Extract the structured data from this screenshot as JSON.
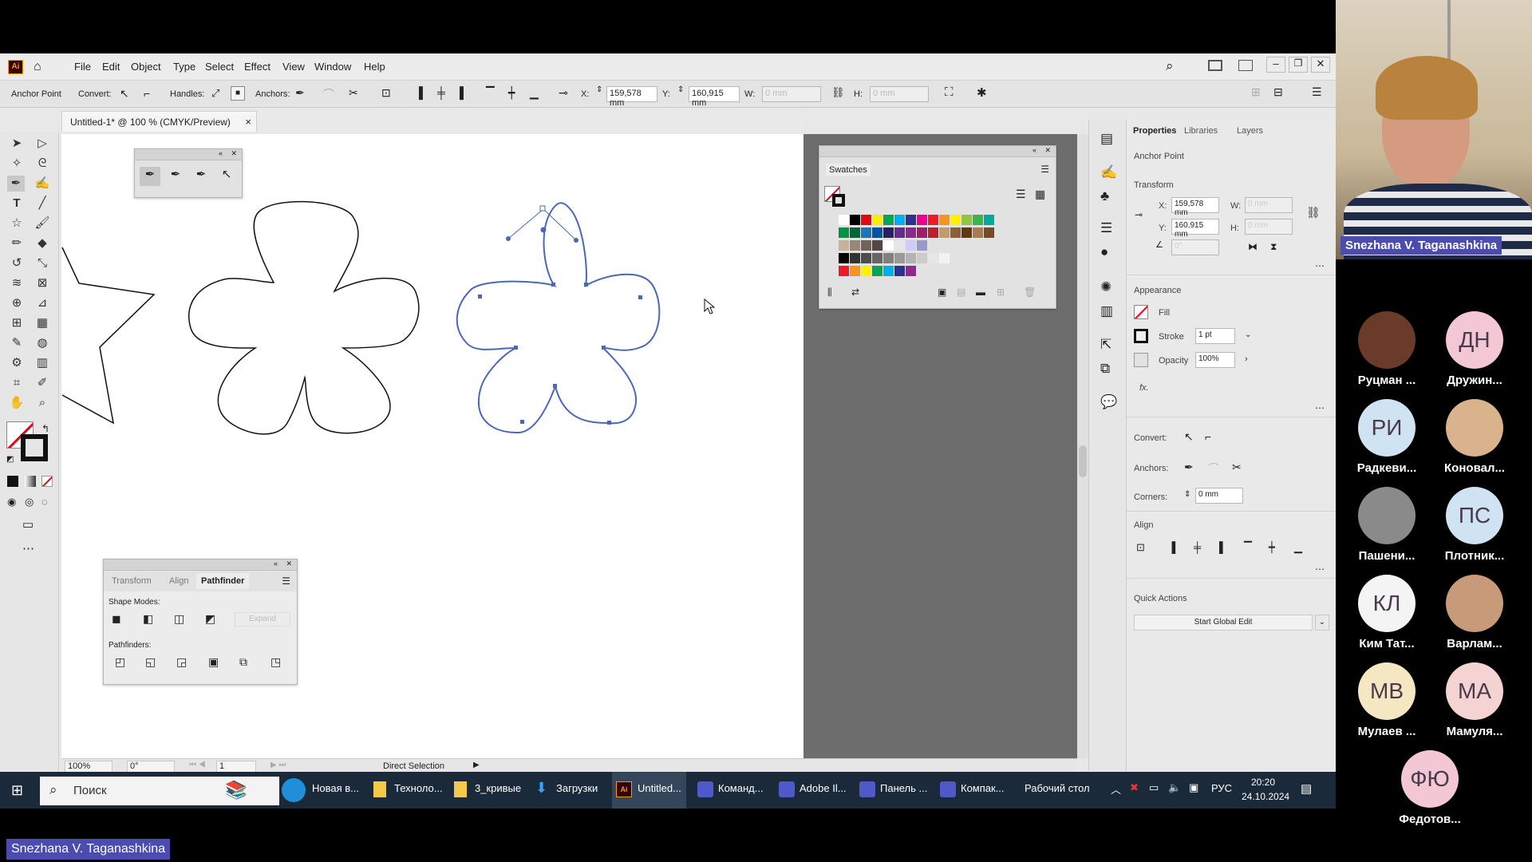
{
  "app": {
    "logo": "Ai",
    "menu": [
      "File",
      "Edit",
      "Object",
      "Type",
      "Select",
      "Effect",
      "View",
      "Window",
      "Help"
    ]
  },
  "control_bar": {
    "selection_label": "Anchor Point",
    "convert_label": "Convert:",
    "handles_label": "Handles:",
    "anchors_label": "Anchors:",
    "x_label": "X:",
    "x_value": "159,578 mm",
    "y_label": "Y:",
    "y_value": "160,915 mm",
    "w_label": "W:",
    "w_value": "0 mm",
    "h_label": "H:",
    "h_value": "0 mm"
  },
  "document": {
    "tab_title": "Untitled-1* @ 100 % (CMYK/Preview)",
    "close": "×"
  },
  "status": {
    "zoom": "100%",
    "rotate": "0°",
    "artboard_num": "1",
    "tool_name": "Direct Selection"
  },
  "swatches_panel": {
    "title": "Swatches",
    "colors_row1": [
      "#ffffff",
      "#000000",
      "#e30613",
      "#ffed00",
      "#00a651",
      "#00aeef",
      "#2e3192",
      "#ec008c",
      "#ed1c24",
      "#f7941d",
      "#fff200",
      "#8dc63f",
      "#39b54a",
      "#00a99d"
    ],
    "colors_row2": [
      "#009444",
      "#006838",
      "#1c75bc",
      "#0054a6",
      "#262262",
      "#662d91",
      "#92278f",
      "#9e1f63",
      "#be1e2d",
      "#c49a6c",
      "#8b5e3c",
      "#603913",
      "#a97c50",
      "#754c24"
    ],
    "colors_row3": [
      "#c7b299",
      "#998675",
      "#736357",
      "#534741",
      "#ffffff",
      "#e6e6e6",
      "#ccccff",
      "#9999cc"
    ],
    "colors_row4": [
      "#000000",
      "#333333",
      "#4d4d4d",
      "#666666",
      "#808080",
      "#999999",
      "#b3b3b3",
      "#cccccc",
      "#e6e6e6",
      "#f2f2f2"
    ],
    "colors_row5": [
      "#ed1c24",
      "#f7941d",
      "#fff200",
      "#00a651",
      "#00aeef",
      "#2e3192",
      "#92278f"
    ]
  },
  "pathfinder_panel": {
    "tabs": [
      "Transform",
      "Align",
      "Pathfinder"
    ],
    "shape_modes_label": "Shape Modes:",
    "expand_label": "Expand",
    "pathfinders_label": "Pathfinders:"
  },
  "properties_panel": {
    "tabs": [
      "Properties",
      "Libraries",
      "Layers"
    ],
    "selection": "Anchor Point",
    "transform_label": "Transform",
    "x_label": "X:",
    "x_value": "159,578 mm",
    "y_label": "Y:",
    "y_value": "160,915 mm",
    "w_label": "W:",
    "w_value": "0 mm",
    "h_label": "H:",
    "h_value": "0 mm",
    "angle_value": "0°",
    "appearance_label": "Appearance",
    "fill_label": "Fill",
    "stroke_label": "Stroke",
    "stroke_value": "1 pt",
    "opacity_label": "Opacity",
    "opacity_value": "100%",
    "fx_label": "fx.",
    "convert_label": "Convert:",
    "anchors_label": "Anchors:",
    "corners_label": "Corners:",
    "corners_value": "0 mm",
    "align_label": "Align",
    "quick_actions_label": "Quick Actions",
    "global_edit_button": "Start Global Edit"
  },
  "taskbar": {
    "search_placeholder": "Поиск",
    "items": [
      "Новая в...",
      "Техноло...",
      "3_кривые",
      "Загрузки",
      "Untitled...",
      "Команд...",
      "Adobe Il...",
      "Панель ...",
      "Компак..."
    ],
    "desktop_label": "Рабочий стол",
    "lang": "РУС",
    "time": "20:20",
    "date": "24.10.2024"
  },
  "video_call": {
    "speaker_name": "Snezhana V. Taganashkina",
    "bottom_name": "Snezhana V. Taganashkina",
    "participants": [
      {
        "initials": "",
        "name": "Руцман ...",
        "bg": "#6b3b2a"
      },
      {
        "initials": "ДН",
        "name": "Дружин...",
        "bg": "#f3c7d3"
      },
      {
        "initials": "РИ",
        "name": "Радкеви...",
        "bg": "#cfe3f3"
      },
      {
        "initials": "",
        "name": "Коновал...",
        "bg": "#d9b38c"
      },
      {
        "initials": "",
        "name": "Пашени...",
        "bg": "#8a8a8a"
      },
      {
        "initials": "ПС",
        "name": "Плотник...",
        "bg": "#cfe3f3"
      },
      {
        "initials": "КЛ",
        "name": "Ким Тат...",
        "bg": "#f4f4f4"
      },
      {
        "initials": "",
        "name": "Варлам...",
        "bg": "#c99a7a"
      },
      {
        "initials": "МВ",
        "name": "Мулаев ...",
        "bg": "#f6e7c3"
      },
      {
        "initials": "МА",
        "name": "Мамуля...",
        "bg": "#f6d3d3"
      },
      {
        "initials": "ФЮ",
        "name": "Федотов...",
        "bg": "#f3c7d3"
      }
    ]
  },
  "colors": {
    "selection_blue": "#4a68b8",
    "taskbar_bg": "#1b2a3a",
    "name_badge": "#4b4bb0"
  }
}
